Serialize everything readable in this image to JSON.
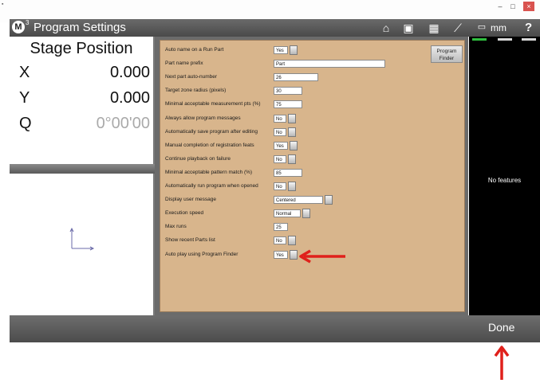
{
  "window": {
    "title": "Program Settings",
    "logo_letter": "M",
    "logo_superscript": "3",
    "units": "mm",
    "help": "?",
    "controls": {
      "minimize": "–",
      "maximize": "□",
      "close": "×"
    }
  },
  "toolbar_icons": [
    "home-icon",
    "video-icon",
    "grid-icon",
    "probe-icon",
    "ruler-icon"
  ],
  "stage": {
    "title": "Stage Position",
    "axes": [
      {
        "label": "X",
        "value": "0.000"
      },
      {
        "label": "Y",
        "value": "0.000"
      },
      {
        "label": "Q",
        "value": "0°00'00"
      }
    ]
  },
  "settings": {
    "program_finder_button": {
      "line1": "Program",
      "line2": "Finder"
    },
    "rows": [
      {
        "label": "Auto name on a Run Part",
        "value": "Yes",
        "control": "dropdown"
      },
      {
        "label": "Part name prefix",
        "value": "Part",
        "control": "text"
      },
      {
        "label": "Next part auto-number",
        "value": "26",
        "control": "text"
      },
      {
        "label": "Target zone radius (pixels)",
        "value": "30",
        "control": "text"
      },
      {
        "label": "Minimal acceptable measurement pts (%)",
        "value": "75",
        "control": "text"
      },
      {
        "label": "Always allow program messages",
        "value": "No",
        "control": "dropdown"
      },
      {
        "label": "Automatically save program after editing",
        "value": "No",
        "control": "dropdown"
      },
      {
        "label": "Manual completion of registration feats",
        "value": "Yes",
        "control": "dropdown"
      },
      {
        "label": "Continue playback on failure",
        "value": "No",
        "control": "dropdown"
      },
      {
        "label": "Minimal acceptable pattern match (%)",
        "value": "85",
        "control": "text"
      },
      {
        "label": "Automatically run program when opened",
        "value": "No",
        "control": "dropdown"
      },
      {
        "label": "Display user message",
        "value": "Centered",
        "control": "dropdown"
      },
      {
        "label": "Execution speed",
        "value": "Normal",
        "control": "dropdown"
      },
      {
        "label": "Max runs",
        "value": "25",
        "control": "text"
      },
      {
        "label": "Show recent Parts list",
        "value": "No",
        "control": "dropdown"
      },
      {
        "label": "Auto play using Program Finder",
        "value": "Yes",
        "control": "dropdown"
      }
    ]
  },
  "features_panel": {
    "empty_text": "No features"
  },
  "bottom": {
    "done_label": "Done"
  },
  "colors": {
    "form_bg": "#d8b58c",
    "annotation_arrow": "#e0201b",
    "panel_dark": "#6b6b6b"
  }
}
